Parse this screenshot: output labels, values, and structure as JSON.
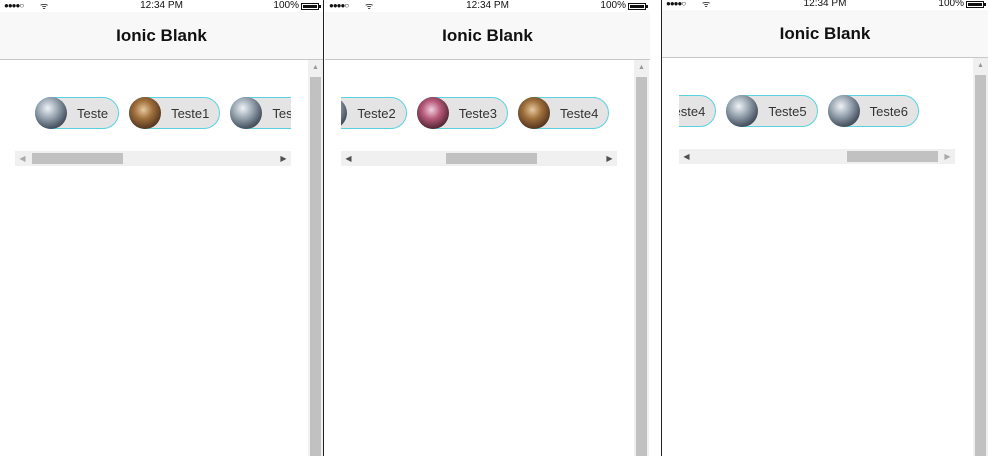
{
  "status_bar": {
    "signal": "●●●●○",
    "wifi": "ᯤ",
    "time": "12:34 PM",
    "battery": "100%"
  },
  "app": {
    "title": "Ionic Blank"
  },
  "chips": [
    {
      "label": "Teste",
      "avatar": "city-photo-icon"
    },
    {
      "label": "Teste1",
      "avatar": "street-photo-icon"
    },
    {
      "label": "Teste2",
      "avatar": "city-photo-icon"
    },
    {
      "label": "Teste3",
      "avatar": "crowd-photo-icon"
    },
    {
      "label": "Teste4",
      "avatar": "street-photo-icon"
    },
    {
      "label": "Teste5",
      "avatar": "city-photo-icon"
    },
    {
      "label": "Teste6",
      "avatar": "city-photo-icon"
    }
  ],
  "frames": [
    {
      "name": "scroll-start",
      "horizontal_scroll_position": 0.0
    },
    {
      "name": "scroll-middle",
      "horizontal_scroll_position": 0.5
    },
    {
      "name": "scroll-end",
      "horizontal_scroll_position": 1.0
    }
  ],
  "icons": {
    "scroll_left": "◀",
    "scroll_right": "▶",
    "scroll_up": "▲"
  }
}
